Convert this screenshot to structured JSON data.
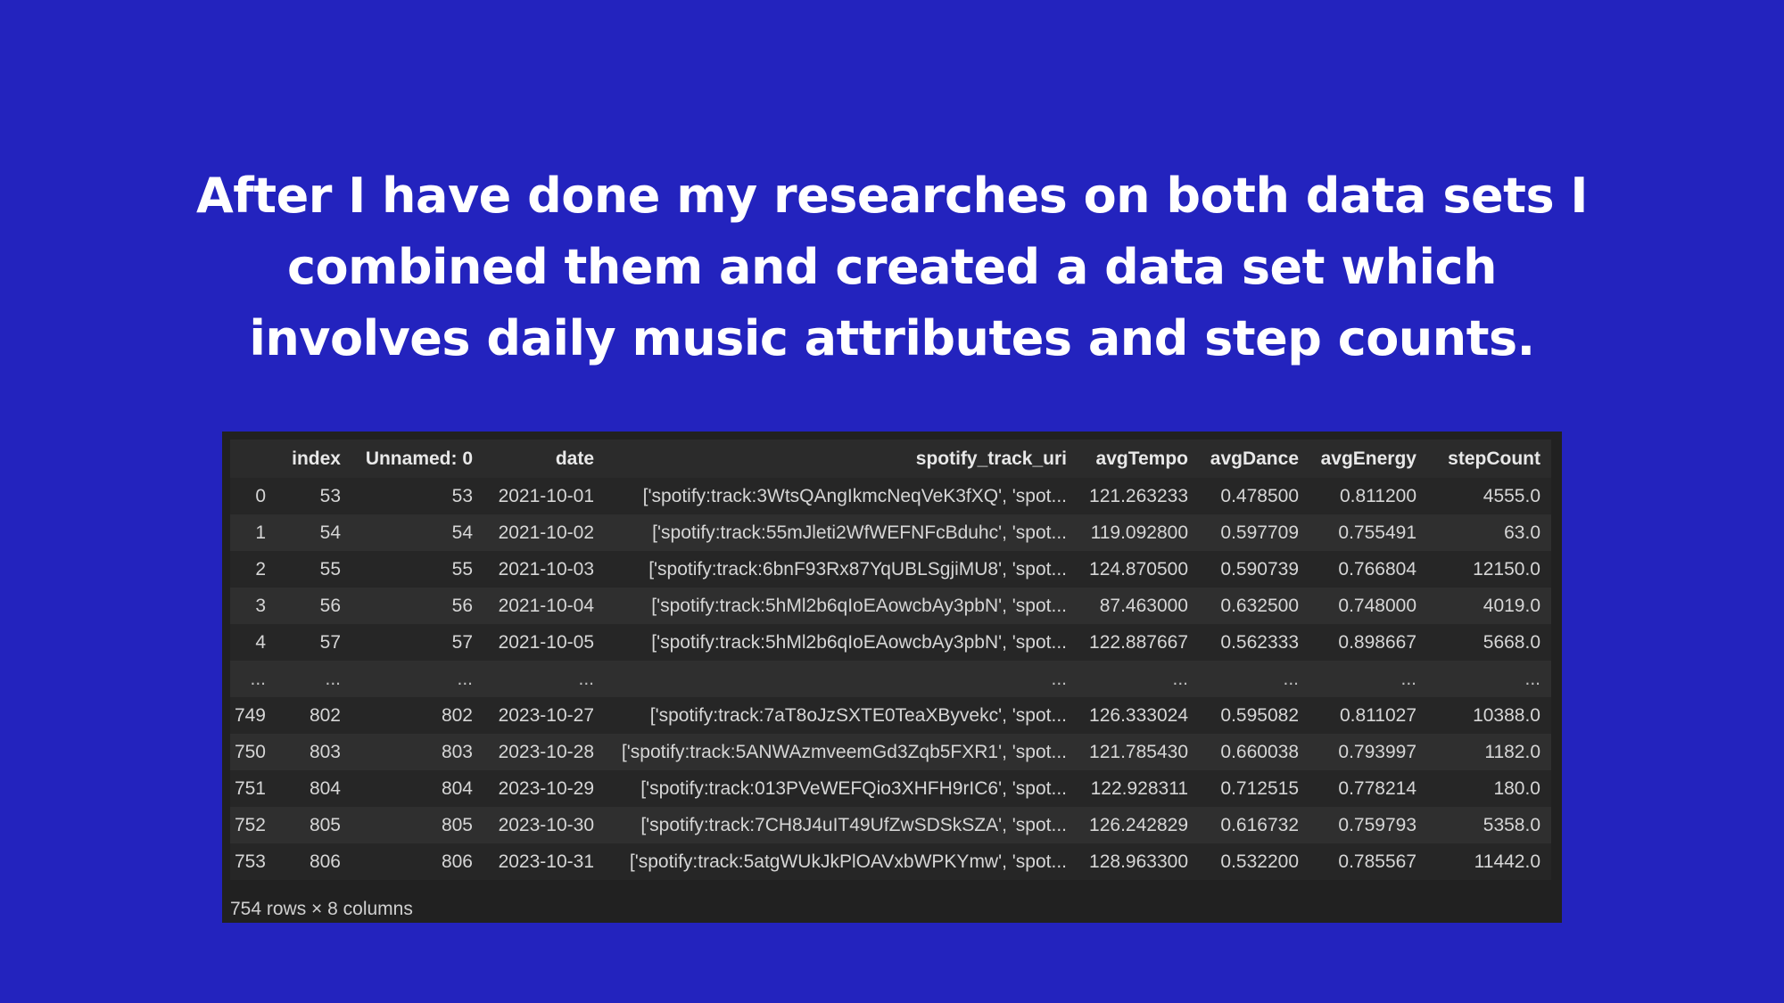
{
  "slide": {
    "headline_lines": [
      "After I have done my researches on both data sets I",
      "combined them and created a data set which",
      "involves daily music attributes and step counts."
    ]
  },
  "dataframe": {
    "columns": [
      "",
      "index",
      "Unnamed: 0",
      "date",
      "spotify_track_uri",
      "avgTempo",
      "avgDance",
      "avgEnergy",
      "stepCount"
    ],
    "rows": [
      [
        "0",
        "53",
        "53",
        "2021-10-01",
        "['spotify:track:3WtsQAngIkmcNeqVeK3fXQ', 'spot...",
        "121.263233",
        "0.478500",
        "0.811200",
        "4555.0"
      ],
      [
        "1",
        "54",
        "54",
        "2021-10-02",
        "['spotify:track:55mJleti2WfWEFNFcBduhc', 'spot...",
        "119.092800",
        "0.597709",
        "0.755491",
        "63.0"
      ],
      [
        "2",
        "55",
        "55",
        "2021-10-03",
        "['spotify:track:6bnF93Rx87YqUBLSgjiMU8', 'spot...",
        "124.870500",
        "0.590739",
        "0.766804",
        "12150.0"
      ],
      [
        "3",
        "56",
        "56",
        "2021-10-04",
        "['spotify:track:5hMl2b6qIoEAowcbAy3pbN', 'spot...",
        "87.463000",
        "0.632500",
        "0.748000",
        "4019.0"
      ],
      [
        "4",
        "57",
        "57",
        "2021-10-05",
        "['spotify:track:5hMl2b6qIoEAowcbAy3pbN', 'spot...",
        "122.887667",
        "0.562333",
        "0.898667",
        "5668.0"
      ],
      [
        "...",
        "...",
        "...",
        "...",
        "...",
        "...",
        "...",
        "...",
        "..."
      ],
      [
        "749",
        "802",
        "802",
        "2023-10-27",
        "['spotify:track:7aT8oJzSXTE0TeaXByvekc', 'spot...",
        "126.333024",
        "0.595082",
        "0.811027",
        "10388.0"
      ],
      [
        "750",
        "803",
        "803",
        "2023-10-28",
        "['spotify:track:5ANWAzmveemGd3Zqb5FXR1', 'spot...",
        "121.785430",
        "0.660038",
        "0.793997",
        "1182.0"
      ],
      [
        "751",
        "804",
        "804",
        "2023-10-29",
        "['spotify:track:013PVeWEFQio3XHFH9rIC6', 'spot...",
        "122.928311",
        "0.712515",
        "0.778214",
        "180.0"
      ],
      [
        "752",
        "805",
        "805",
        "2023-10-30",
        "['spotify:track:7CH8J4uIT49UfZwSDSkSZA', 'spot...",
        "126.242829",
        "0.616732",
        "0.759793",
        "5358.0"
      ],
      [
        "753",
        "806",
        "806",
        "2023-10-31",
        "['spotify:track:5atgWUkJkPlOAVxbWPKYmw', 'spot...",
        "128.963300",
        "0.532200",
        "0.785567",
        "11442.0"
      ]
    ],
    "shape_label": "754 rows × 8 columns"
  }
}
